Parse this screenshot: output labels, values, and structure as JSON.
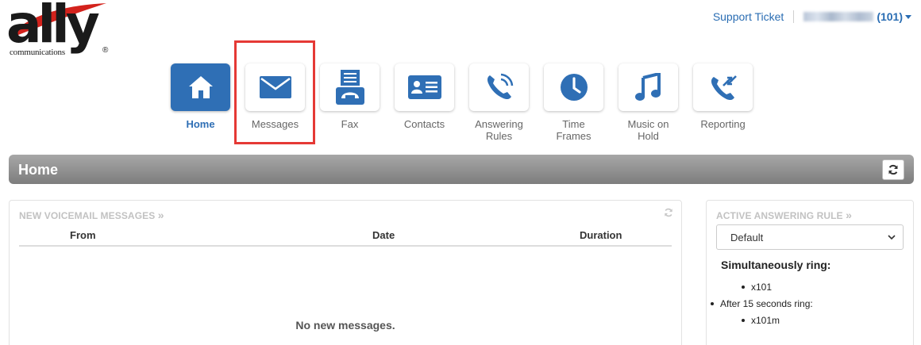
{
  "logo": {
    "word": "ally",
    "sub": "communications",
    "reg": "®"
  },
  "header": {
    "support_label": "Support Ticket",
    "user_ext": "(101)"
  },
  "nav": {
    "home": "Home",
    "messages": "Messages",
    "fax": "Fax",
    "contacts": "Contacts",
    "answering_rules_1": "Answering",
    "answering_rules_2": "Rules",
    "time_frames": "Time Frames",
    "music_on_hold_1": "Music on",
    "music_on_hold_2": "Hold",
    "reporting": "Reporting"
  },
  "page": {
    "title": "Home"
  },
  "voicemail": {
    "heading": "NEW VOICEMAIL MESSAGES",
    "arrow": "»",
    "col_from": "From",
    "col_date": "Date",
    "col_duration": "Duration",
    "empty": "No new messages."
  },
  "answering": {
    "heading": "ACTIVE ANSWERING RULE",
    "arrow": "»",
    "selected": "Default",
    "sim_ring": "Simultaneously ring:",
    "item1": "x101",
    "after": "After 15 seconds ring:",
    "item2": "x101m"
  },
  "colors": {
    "accent": "#2f6fb5",
    "highlight": "#e53935",
    "bar": "#8f8f8f"
  }
}
